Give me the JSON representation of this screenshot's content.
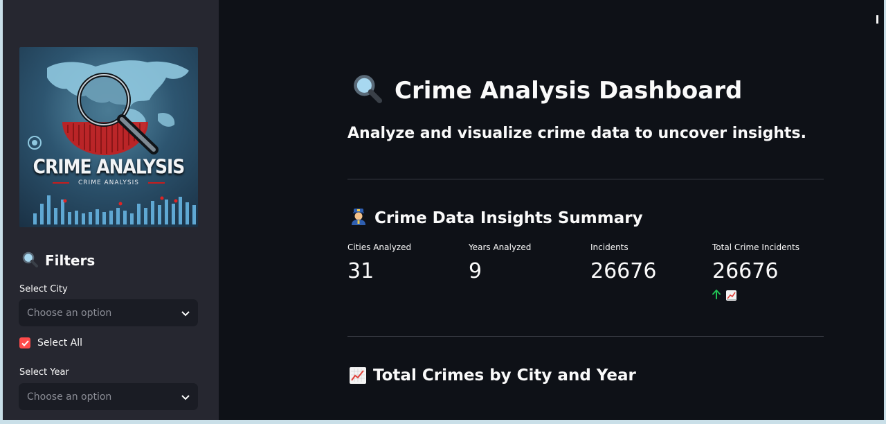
{
  "sidebar": {
    "logo": {
      "title": "CRIME ANALYSIS",
      "subtitle": "CRIME ANALYSIS"
    },
    "filters_heading": "Filters",
    "filters_icon": "magnifier-icon",
    "city_label": "Select City",
    "city_placeholder": "Choose an option",
    "select_all_label": "Select All",
    "select_all_checked": true,
    "year_label": "Select Year",
    "year_placeholder": "Choose an option"
  },
  "main": {
    "title": "Crime Analysis Dashboard",
    "title_icon": "magnifier-icon",
    "subtitle": "Analyze and visualize crime data to uncover insights.",
    "summary_heading": "Crime Data Insights Summary",
    "summary_icon": "police-officer-icon",
    "metrics": [
      {
        "label": "Cities Analyzed",
        "value": "31"
      },
      {
        "label": "Years Analyzed",
        "value": "9"
      },
      {
        "label": "Incidents",
        "value": "26676"
      },
      {
        "label": "Total Crime Incidents",
        "value": "26676",
        "delta_icons": [
          "up-arrow-icon",
          "chart-increasing-icon"
        ]
      }
    ],
    "chart_heading": "Total Crimes by City and Year",
    "chart_heading_icon": "chart-increasing-icon"
  },
  "colors": {
    "app_background": "#0e1117",
    "sidebar_background": "#262730",
    "input_background": "#1a1c24",
    "checkbox_accent": "#ff4b4b",
    "delta_positive": "#21c354",
    "text": "#fafafa",
    "placeholder": "#8b8d96"
  }
}
